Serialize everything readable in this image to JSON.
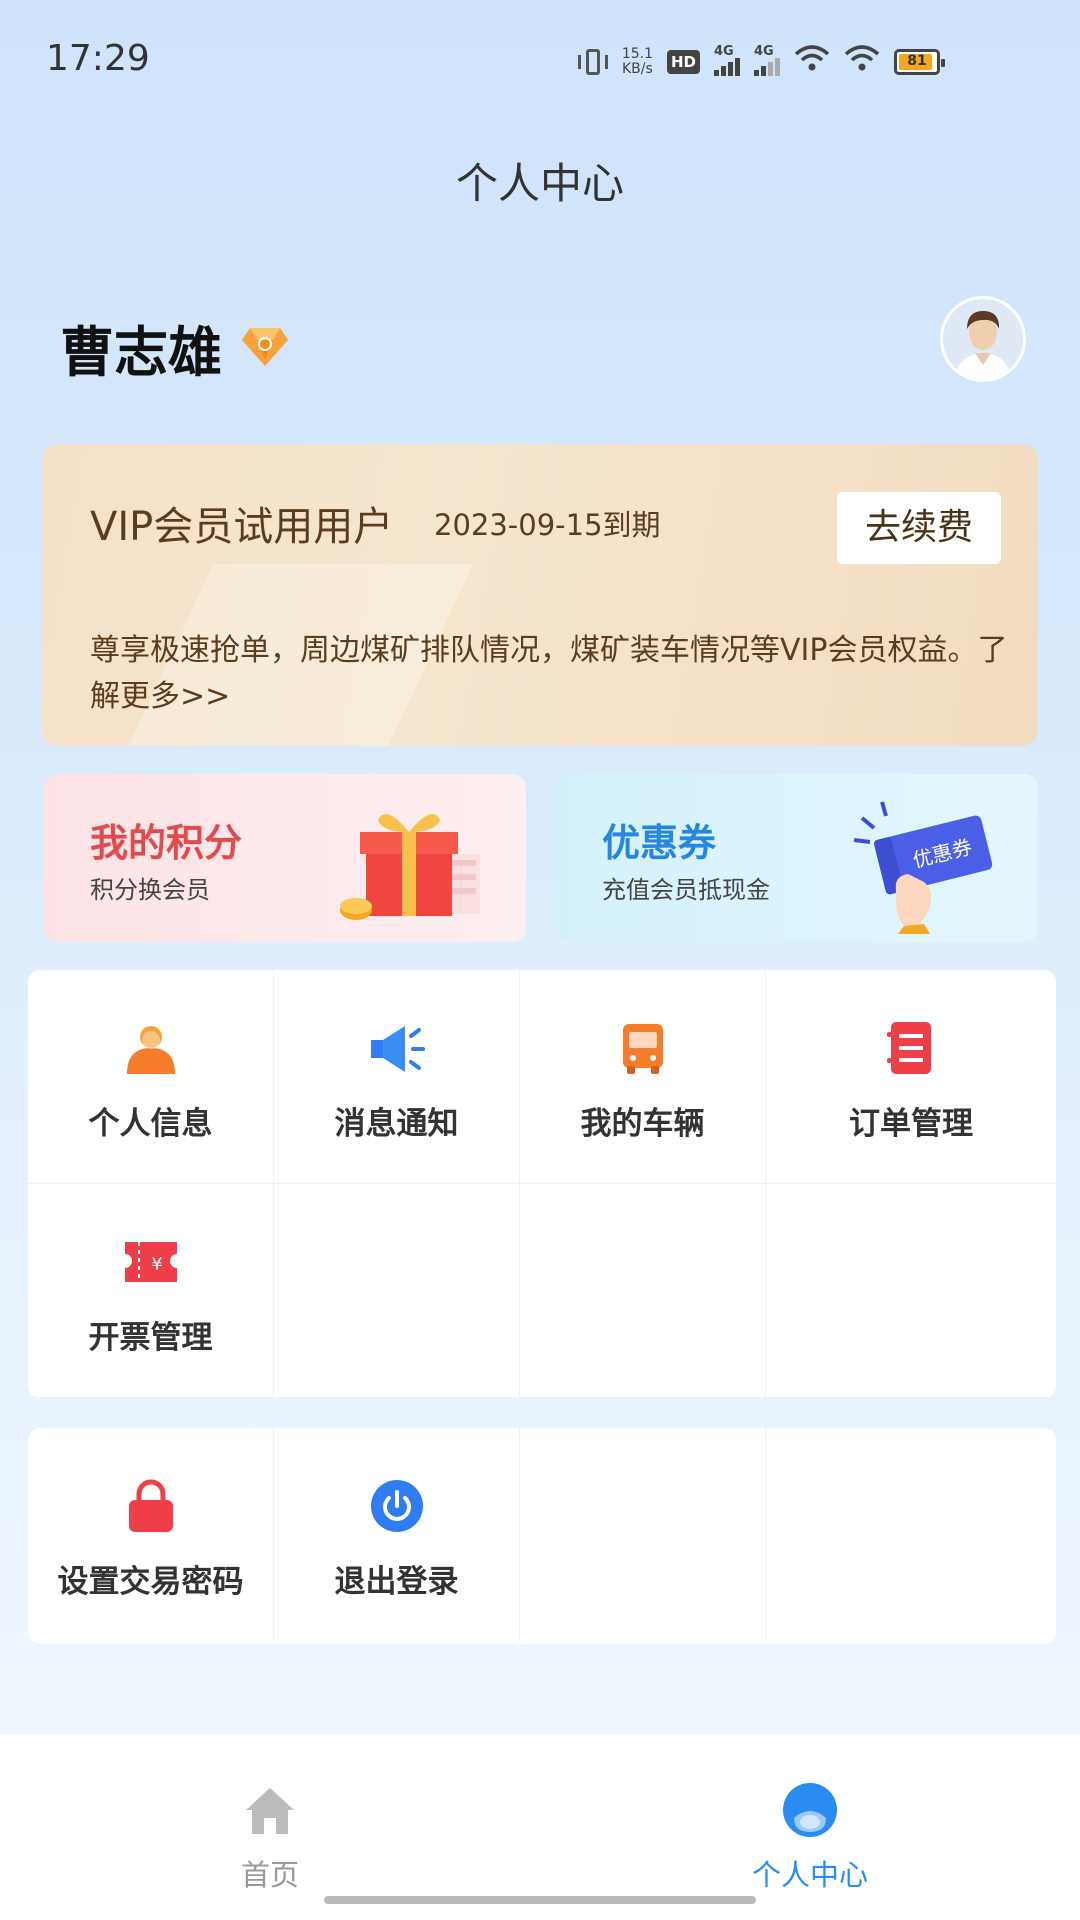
{
  "status_bar": {
    "time": "17:29",
    "net_speed_value": "15.1",
    "net_speed_unit": "KB/s",
    "hd_label": "HD",
    "sim1": "4G",
    "sim2": "4G",
    "battery": "81"
  },
  "header": {
    "title": "个人中心"
  },
  "user": {
    "name": "曹志雄"
  },
  "vip": {
    "title": "VIP会员试用用户",
    "expire": "2023-09-15到期",
    "renew_label": "去续费",
    "description": "尊享极速抢单，周边煤矿排队情况，煤矿装车情况等VIP会员权益。了解更多>>"
  },
  "promos": {
    "points": {
      "title": "我的积分",
      "subtitle": "积分换会员"
    },
    "coupon": {
      "title": "优惠券",
      "subtitle": "充值会员抵现金",
      "ticket_text": "优惠券"
    }
  },
  "menu": [
    {
      "label": "个人信息",
      "icon": "person-icon"
    },
    {
      "label": "消息通知",
      "icon": "megaphone-icon"
    },
    {
      "label": "我的车辆",
      "icon": "bus-icon"
    },
    {
      "label": "订单管理",
      "icon": "order-icon"
    },
    {
      "label": "开票管理",
      "icon": "invoice-icon"
    }
  ],
  "menu2": [
    {
      "label": "设置交易密码",
      "icon": "lock-icon"
    },
    {
      "label": "退出登录",
      "icon": "power-icon"
    }
  ],
  "bottom_nav": {
    "home": "首页",
    "me": "个人中心",
    "active": "me",
    "active_color": "#2a8cf0"
  },
  "colors": {
    "points_accent": "#e24b4b",
    "coupon_accent": "#2687e2",
    "vip_text": "#5a3d1e"
  }
}
